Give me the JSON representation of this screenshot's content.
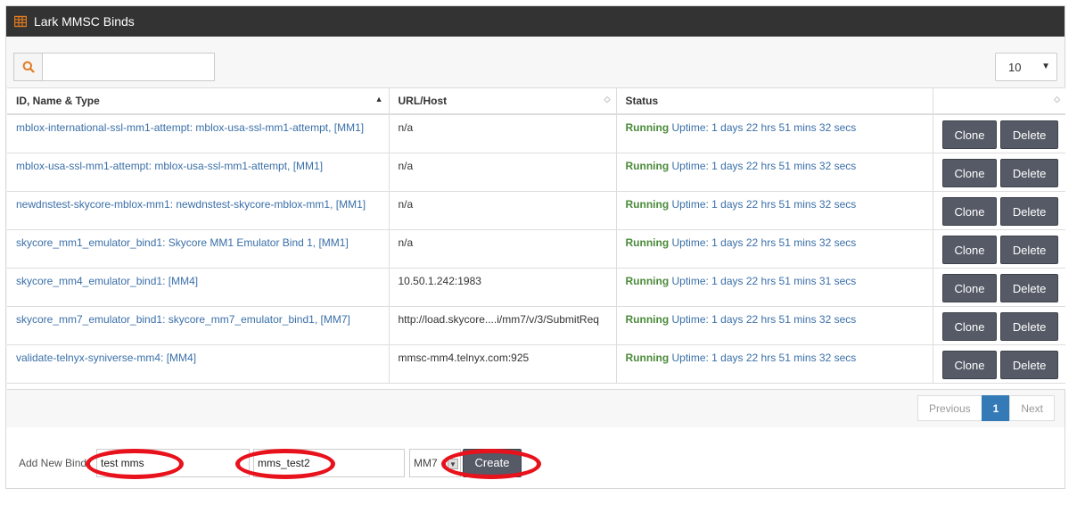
{
  "panel": {
    "title": "Lark MMSC Binds",
    "accent": "#e07a1f"
  },
  "toolbar": {
    "search_placeholder": "",
    "search_value": "",
    "page_size": "10"
  },
  "table": {
    "columns": [
      "ID, Name & Type",
      "URL/Host",
      "Status",
      ""
    ],
    "rows": [
      {
        "name": "mblox-international-ssl-mm1-attempt: mblox-usa-ssl-mm1-attempt, [MM1]",
        "url": "n/a",
        "status": "Running",
        "uptime": "Uptime: 1 days 22 hrs 51 mins 32 secs",
        "clone": "Clone",
        "delete": "Delete"
      },
      {
        "name": "mblox-usa-ssl-mm1-attempt: mblox-usa-ssl-mm1-attempt, [MM1]",
        "url": "n/a",
        "status": "Running",
        "uptime": "Uptime: 1 days 22 hrs 51 mins 32 secs",
        "clone": "Clone",
        "delete": "Delete"
      },
      {
        "name": "newdnstest-skycore-mblox-mm1: newdnstest-skycore-mblox-mm1, [MM1]",
        "url": "n/a",
        "status": "Running",
        "uptime": "Uptime: 1 days 22 hrs 51 mins 32 secs",
        "clone": "Clone",
        "delete": "Delete"
      },
      {
        "name": "skycore_mm1_emulator_bind1: Skycore MM1 Emulator Bind 1, [MM1]",
        "url": "n/a",
        "status": "Running",
        "uptime": "Uptime: 1 days 22 hrs 51 mins 32 secs",
        "clone": "Clone",
        "delete": "Delete"
      },
      {
        "name": "skycore_mm4_emulator_bind1: [MM4]",
        "url": "10.50.1.242:1983",
        "status": "Running",
        "uptime": "Uptime: 1 days 22 hrs 51 mins 31 secs",
        "clone": "Clone",
        "delete": "Delete"
      },
      {
        "name": "skycore_mm7_emulator_bind1: skycore_mm7_emulator_bind1, [MM7]",
        "url": "http://load.skycore....i/mm7/v/3/SubmitReq",
        "status": "Running",
        "uptime": "Uptime: 1 days 22 hrs 51 mins 32 secs",
        "clone": "Clone",
        "delete": "Delete"
      },
      {
        "name": "validate-telnyx-syniverse-mm4: [MM4]",
        "url": "mmsc-mm4.telnyx.com:925",
        "status": "Running",
        "uptime": "Uptime: 1 days 22 hrs 51 mins 32 secs",
        "clone": "Clone",
        "delete": "Delete"
      }
    ]
  },
  "pager": {
    "previous": "Previous",
    "current": "1",
    "next": "Next"
  },
  "add_bind": {
    "label": "Add New Bind:",
    "id_value": "test mms",
    "name_value": "mms_test2",
    "type_value": "MM7",
    "create_label": "Create"
  }
}
